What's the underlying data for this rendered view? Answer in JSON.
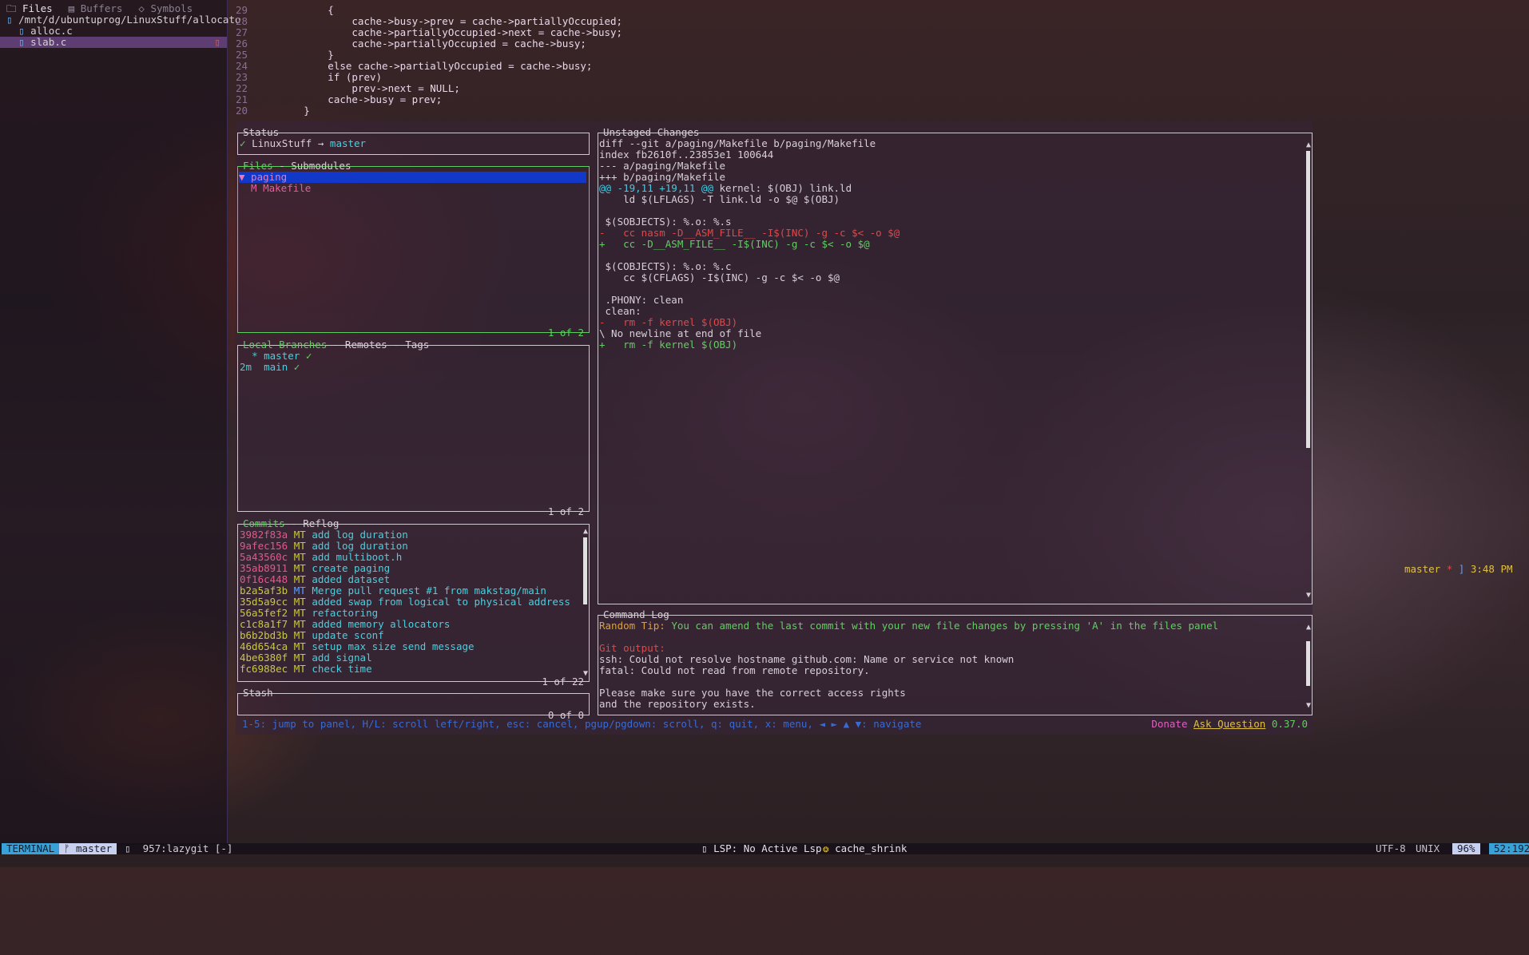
{
  "tree": {
    "tabs": [
      {
        "label": "Files",
        "icon": "folder-icon",
        "active": true
      },
      {
        "label": "Buffers",
        "icon": "buffers-icon",
        "active": false
      },
      {
        "label": "Symbols",
        "icon": "symbols-icon",
        "active": false
      }
    ],
    "root": "/mnt/d/ubuntuprog/LinuxStuff/allocato",
    "files": [
      {
        "name": "alloc.c",
        "selected": false,
        "dirty": false
      },
      {
        "name": "slab.c",
        "selected": true,
        "dirty": true
      }
    ]
  },
  "code": {
    "lines": [
      {
        "num": "29",
        "text": "            {"
      },
      {
        "num": "28",
        "text": "                cache->busy->prev = cache->partiallyOccupied;"
      },
      {
        "num": "27",
        "text": "                cache->partiallyOccupied->next = cache->busy;"
      },
      {
        "num": "26",
        "text": "                cache->partiallyOccupied = cache->busy;"
      },
      {
        "num": "25",
        "text": "            }"
      },
      {
        "num": "24",
        "text": "            else cache->partiallyOccupied = cache->busy;"
      },
      {
        "num": "23",
        "text": "            if (prev)"
      },
      {
        "num": "22",
        "text": "                prev->next = NULL;"
      },
      {
        "num": "21",
        "text": "            cache->busy = prev;"
      },
      {
        "num": "20",
        "text": "        }"
      }
    ]
  },
  "lazygit": {
    "status": {
      "title": "Status",
      "check": "✓",
      "repo": "LinuxStuff",
      "arrow": "→",
      "branch": "master"
    },
    "files": {
      "title_active": "Files",
      "sep": " - ",
      "title_other": "Submodules",
      "rows": [
        {
          "text": "▼ paging",
          "selected": true
        },
        {
          "text": "  M Makefile",
          "selected": false
        }
      ],
      "footer": "1 of 2"
    },
    "branches": {
      "title_active": "Local Branches",
      "rest": " - Remotes - Tags",
      "rows": [
        {
          "age": "",
          "star": "*",
          "name": "master",
          "check": "✓"
        },
        {
          "age": "2m",
          "star": "",
          "name": "main",
          "check": "✓"
        }
      ],
      "footer": "1 of 2"
    },
    "commits": {
      "title_active": "Commits",
      "rest": " - Reflog",
      "rows": [
        {
          "sha": "3982f83a",
          "author": "MT",
          "msg": "add log duration",
          "pushed": false
        },
        {
          "sha": "9afec156",
          "author": "MT",
          "msg": "add log duration",
          "pushed": false
        },
        {
          "sha": "5a43560c",
          "author": "MT",
          "msg": "add multiboot.h",
          "pushed": false
        },
        {
          "sha": "35ab8911",
          "author": "MT",
          "msg": "create paging",
          "pushed": false
        },
        {
          "sha": "0f16c448",
          "author": "MT",
          "msg": "added dataset",
          "pushed": false
        },
        {
          "sha": "b2a5af3b",
          "author": "MT",
          "msg": "Merge pull request #1 from makstag/main",
          "pushed": true
        },
        {
          "sha": "35d5a9cc",
          "author": "MT",
          "msg": "added swap from logical to physical address",
          "pushed": true
        },
        {
          "sha": "56a5fef2",
          "author": "MT",
          "msg": "refactoring",
          "pushed": true
        },
        {
          "sha": "c1c8a1f7",
          "author": "MT",
          "msg": "added memory allocators",
          "pushed": true
        },
        {
          "sha": "b6b2bd3b",
          "author": "MT",
          "msg": "update sconf",
          "pushed": true
        },
        {
          "sha": "46d654ca",
          "author": "MT",
          "msg": "setup max size send message",
          "pushed": true
        },
        {
          "sha": "4be6380f",
          "author": "MT",
          "msg": "add signal",
          "pushed": true
        },
        {
          "sha": "fc6988ec",
          "author": "MT",
          "msg": "check time",
          "pushed": true
        }
      ],
      "footer": "1 of 22"
    },
    "stash": {
      "title": "Stash",
      "footer": "0 of 0"
    },
    "diff": {
      "title": "Unstaged Changes",
      "lines": [
        {
          "t": "h",
          "text": "diff --git a/paging/Makefile b/paging/Makefile"
        },
        {
          "t": "h",
          "text": "index fb2610f..23853e1 100644"
        },
        {
          "t": "h",
          "text": "--- a/paging/Makefile"
        },
        {
          "t": "h",
          "text": "+++ b/paging/Makefile"
        },
        {
          "t": "hunk",
          "text": "@@ -19,11 +19,11 @@",
          "rest": " kernel: $(OBJ) link.ld"
        },
        {
          "t": "n",
          "text": "    ld $(LFLAGS) -T link.ld -o $@ $(OBJ)"
        },
        {
          "t": "n",
          "text": ""
        },
        {
          "t": "n",
          "text": " $(SOBJECTS): %.o: %.s"
        },
        {
          "t": "d",
          "text": "-   cc nasm -D__ASM_FILE__ -I$(INC) -g -c $< -o $@"
        },
        {
          "t": "a",
          "text": "+   cc -D__ASM_FILE__ -I$(INC) -g -c $< -o $@"
        },
        {
          "t": "n",
          "text": ""
        },
        {
          "t": "n",
          "text": " $(COBJECTS): %.o: %.c"
        },
        {
          "t": "n",
          "text": "    cc $(CFLAGS) -I$(INC) -g -c $< -o $@"
        },
        {
          "t": "n",
          "text": ""
        },
        {
          "t": "n",
          "text": " .PHONY: clean"
        },
        {
          "t": "n",
          "text": " clean:"
        },
        {
          "t": "d",
          "text": "-   rm -f kernel $(OBJ)"
        },
        {
          "t": "n",
          "text": "\\ No newline at end of file"
        },
        {
          "t": "a",
          "text": "+   rm -f kernel $(OBJ)"
        }
      ]
    },
    "cmdlog": {
      "title": "Command Log",
      "tip_label": "Random Tip:",
      "tip": " You can amend the last commit with your new file changes by pressing 'A' in the files panel",
      "git_output": "Git output:",
      "lines": [
        "ssh: Could not resolve hostname github.com: Name or service not known",
        "fatal: Could not read from remote repository.",
        "",
        "Please make sure you have the correct access rights",
        "and the repository exists."
      ]
    },
    "keys": "1-5: jump to panel, H/L: scroll left/right, esc: cancel, pgup/pgdown: scroll, q: quit, x: menu, ◄ ► ▲ ▼: navigate",
    "donate": "Donate",
    "ask": "Ask Question",
    "version": "0.37.0"
  },
  "shell_status": {
    "branch": "master",
    "mark": "*",
    "bracket": "]",
    "time": "3:48 PM"
  },
  "statusline": {
    "mode": "TERMINAL",
    "branch": "master",
    "term": "957:lazygit [-]",
    "lsp": "LSP: No Active Lsp",
    "proj": "cache_shrink",
    "enc": "UTF-8",
    "fmt": "UNIX",
    "pct": "96%",
    "pos": "52:192"
  }
}
